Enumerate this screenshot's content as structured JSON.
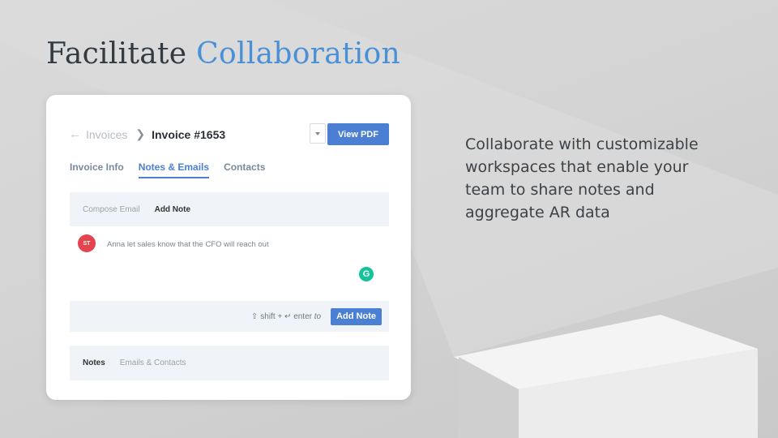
{
  "slide": {
    "title_part1": "Facilitate",
    "title_part2": "Collaboration",
    "description": "Collaborate with customizable workspaces that enable your team to share notes and aggregate AR data"
  },
  "invoice_card": {
    "breadcrumb": {
      "back": "Invoices",
      "current": "Invoice #1653"
    },
    "view_pdf_label": "View PDF",
    "tabs": [
      {
        "label": "Invoice Info",
        "active": false
      },
      {
        "label": "Notes & Emails",
        "active": true
      },
      {
        "label": "Contacts",
        "active": false
      }
    ],
    "compose_options": [
      "Compose Email",
      "Add Note"
    ],
    "note": {
      "avatar_initials": "ST",
      "text": "Anna let sales know that the CFO will reach out"
    },
    "hint": {
      "shift": "shift",
      "plus": "+",
      "enter_word": "enter",
      "to": "to"
    },
    "add_note_label": "Add Note",
    "lower_tabs": [
      "Notes",
      "Emails & Contacts"
    ]
  },
  "icons": [
    "back-arrow-icon",
    "chevron-right-icon",
    "caret-down-icon",
    "shift-arrow-icon",
    "enter-icon",
    "grammarly-icon"
  ],
  "colors": {
    "accent": "#4a90d6",
    "button": "#4a7fd4",
    "avatar": "#e3444e",
    "grammarly": "#15c39a"
  }
}
